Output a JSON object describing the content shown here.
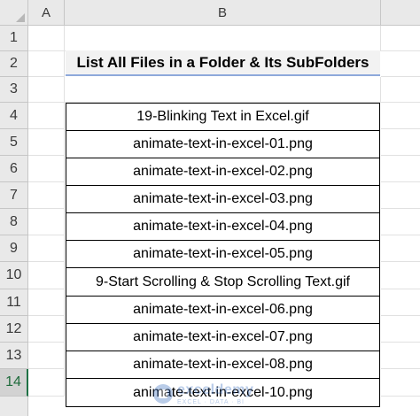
{
  "spreadsheet": {
    "columns": [
      "A",
      "B"
    ],
    "rows": [
      "1",
      "2",
      "3",
      "4",
      "5",
      "6",
      "7",
      "8",
      "9",
      "10",
      "11",
      "12",
      "13",
      "14"
    ],
    "selected_row": "14"
  },
  "title": "List All Files in a Folder & Its SubFolders",
  "files": [
    "19-Blinking Text in Excel.gif",
    "animate-text-in-excel-01.png",
    "animate-text-in-excel-02.png",
    "animate-text-in-excel-03.png",
    "animate-text-in-excel-04.png",
    "animate-text-in-excel-05.png",
    "9-Start Scrolling & Stop Scrolling Text.gif",
    "animate-text-in-excel-06.png",
    "animate-text-in-excel-07.png",
    "animate-text-in-excel-08.png",
    "animate-text-in-excel-10.png"
  ],
  "watermark": {
    "name": "exceldemy",
    "tagline": "EXCEL · DATA · BI"
  },
  "colors": {
    "header_bg": "#e9e9e9",
    "title_bg": "#f2f2f2",
    "title_underline": "#8ea9db",
    "selected_row_accent": "#1e7145"
  }
}
